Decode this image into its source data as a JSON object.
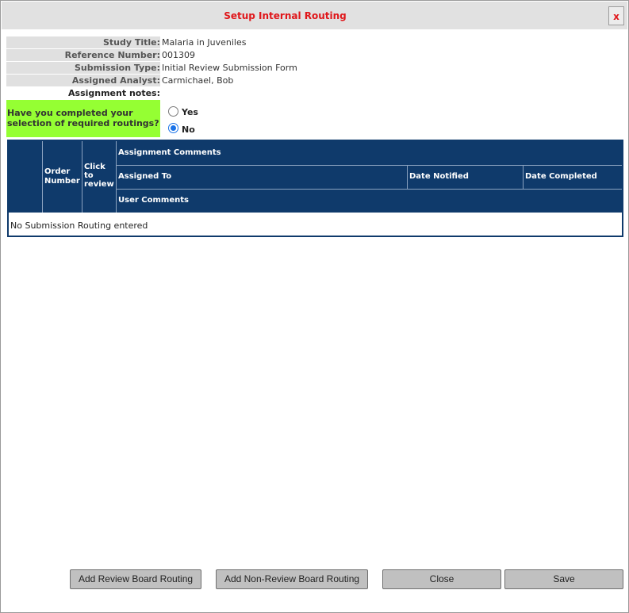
{
  "dialog": {
    "title": "Setup Internal Routing",
    "close_label": "x"
  },
  "info": [
    {
      "label": "Study Title:",
      "value": "Malaria in Juveniles"
    },
    {
      "label": "Reference Number:",
      "value": "001309"
    },
    {
      "label": "Submission Type:",
      "value": "Initial Review Submission Form"
    },
    {
      "label": "Assigned Analyst:",
      "value": "Carmichael, Bob"
    },
    {
      "label": "Assignment notes:",
      "value": ""
    }
  ],
  "question": {
    "text": "Have you completed your selection of required routings?",
    "options": [
      {
        "label": "Yes",
        "checked": false
      },
      {
        "label": "No",
        "checked": true
      }
    ]
  },
  "grid": {
    "col_order": "Order Number",
    "col_click": "Click to review",
    "row1_assignment_comments": "Assignment Comments",
    "row2_assigned_to": "Assigned To",
    "row2_date_notified": "Date Notified",
    "row2_date_completed": "Date Completed",
    "row3_user_comments": "User Comments",
    "empty_message": "No Submission Routing entered"
  },
  "buttons": {
    "add_review": "Add Review Board Routing",
    "add_non_review": "Add Non-Review Board Routing",
    "close": "Close",
    "save": "Save"
  },
  "colors": {
    "title": "#e0161a",
    "question_bg": "#95ff33",
    "grid_header": "#0f3a6b",
    "label_bg": "#e0e0e0",
    "radio_selected": "#1a73e8"
  }
}
